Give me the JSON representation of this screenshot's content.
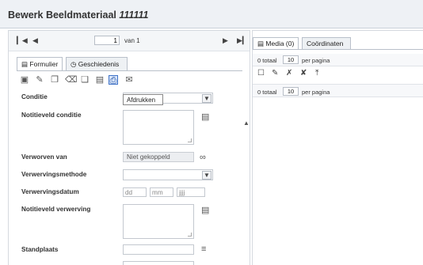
{
  "window": {
    "title_prefix": "Bewerk Beeldmateriaal",
    "title_id": "111111"
  },
  "pager": {
    "first": "⏮",
    "prev": "◀",
    "current_page": "1",
    "of_label": "van 1",
    "next": "▶",
    "last": "⏭"
  },
  "tabs": [
    {
      "label": "Formulier",
      "icon": "form-icon",
      "active": true
    },
    {
      "label": "Geschiedenis",
      "icon": "history-icon",
      "active": false
    }
  ],
  "toolbar": {
    "icons": [
      "save-icon",
      "edit-icon",
      "copy-icon",
      "delete-icon",
      "duplicate-icon",
      "document-icon",
      "print-icon",
      "email-icon"
    ],
    "selected": "print-icon",
    "tooltip": "Afdrukken"
  },
  "form": {
    "conditie_label": "Conditie",
    "notitie_conditie_label": "Notitieveld conditie",
    "verworven_van_label": "Verworven van",
    "verworven_van_value": "Niet gekoppeld",
    "verwervingsmethode_label": "Verwervingsmethode",
    "verwervingsdatum_label": "Verwervingsdatum",
    "date_dd": "dd",
    "date_mm": "mm",
    "date_jjjj": "jjjj",
    "notitie_verwerving_label": "Notitieveld verwerving",
    "standplaats_label": "Standplaats"
  },
  "right_panel": {
    "tabs": [
      {
        "label": "Media (0)",
        "icon": "media-icon",
        "active": true
      },
      {
        "label": "Coördinaten",
        "active": false
      }
    ],
    "total_label": "0 totaal",
    "per_page_value": "10",
    "per_page_label": "per pagina",
    "icons": [
      "checkbox-icon",
      "edit-link-icon",
      "unlink-icon",
      "unlink-all-icon",
      "upload-icon"
    ]
  },
  "colors": {
    "accent": "#3e72c8",
    "titlebar_bg": "#eef1f5"
  }
}
